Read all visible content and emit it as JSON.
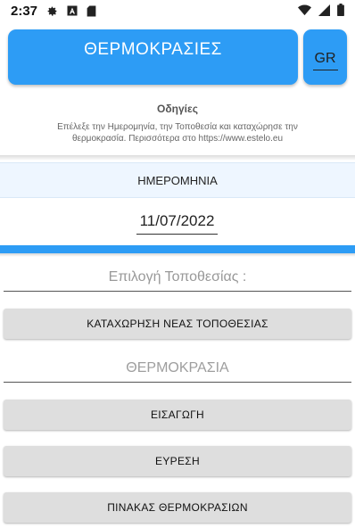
{
  "status_bar": {
    "time": "2:37",
    "icons": [
      "gear-icon",
      "font-a-icon",
      "sd-card-icon",
      "wifi-icon",
      "cellular-icon",
      "battery-icon"
    ]
  },
  "header": {
    "title_button": "ΘΕΡΜΟΚΡΑΣΙΕΣ",
    "language_button": "GR"
  },
  "instructions": {
    "title": "Οδηγίες",
    "text": "Επέλεξε την Ημερομηνία, την Τοποθεσία και καταχώρησε την θερμοκρασία. Περισσότερα στο https://www.estelo.eu"
  },
  "date": {
    "label": "ΗΜΕΡΟΜΗΝΙΑ",
    "value": "11/07/2022"
  },
  "location": {
    "placeholder": "Επιλογή Τοποθεσίας :",
    "new_location_button": "ΚΑΤΑΧΩΡΗΣΗ ΝΕΑΣ ΤΟΠΟΘΕΣΙΑΣ"
  },
  "temperature": {
    "placeholder": "ΘΕΡΜΟΚΡΑΣΙΑ"
  },
  "actions": {
    "insert_button": "ΕΙΣΑΓΩΓΗ",
    "find_button": "ΕΥΡΕΣΗ",
    "table_button": "ΠΙΝΑΚΑΣ ΘΕΡΜΟΚΡΑΣΙΩΝ"
  },
  "colors": {
    "accent": "#2d9cf5",
    "button_gray": "#dedede"
  }
}
